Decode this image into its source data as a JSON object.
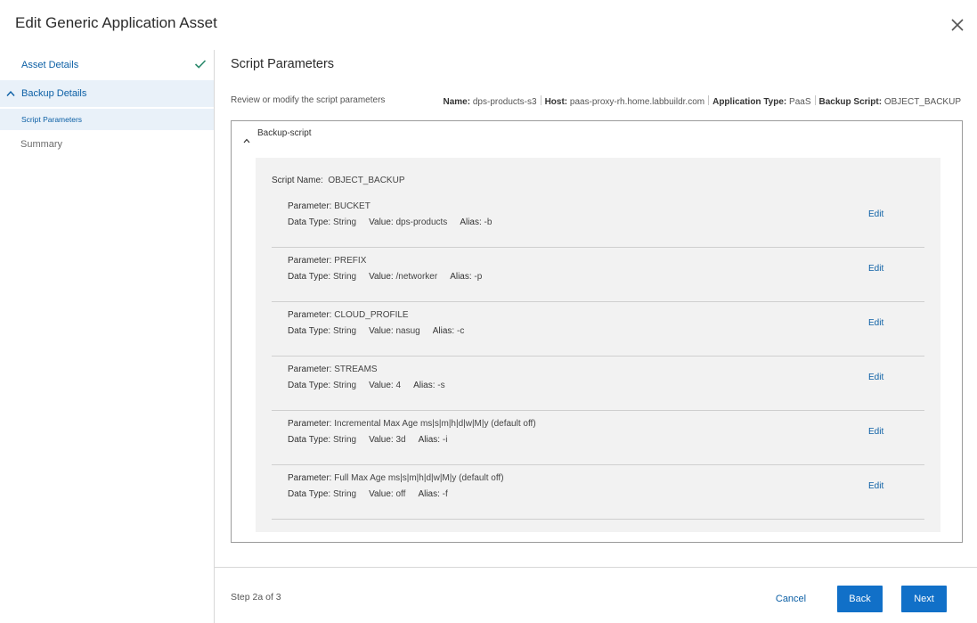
{
  "dialog": {
    "title": "Edit Generic Application Asset",
    "close_icon": "close-icon"
  },
  "sidebar": {
    "items": [
      {
        "label": "Asset Details",
        "state": "completed",
        "icon": "check-icon"
      },
      {
        "label": "Backup Details",
        "state": "expanded",
        "icon": "chevron-up-icon"
      },
      {
        "label": "Script Parameters",
        "state": "active"
      },
      {
        "label": "Summary",
        "state": "pending"
      }
    ]
  },
  "main": {
    "title": "Script Parameters",
    "subtitle": "Review or modify the script parameters",
    "meta": {
      "name_label": "Name:",
      "name_value": "dps-products-s3",
      "host_label": "Host:",
      "host_value": "paas-proxy-rh.home.labbuildr.com",
      "app_type_label": "Application Type:",
      "app_type_value": "PaaS",
      "backup_script_label": "Backup Script:",
      "backup_script_value": "OBJECT_BACKUP"
    },
    "section": {
      "title": "Backup-script",
      "script_name_label": "Script Name:",
      "script_name_value": "OBJECT_BACKUP",
      "labels": {
        "parameter": "Parameter:",
        "data_type": "Data Type:",
        "value": "Value:",
        "alias": "Alias:",
        "edit": "Edit"
      },
      "parameters": [
        {
          "name": "BUCKET",
          "data_type": "String",
          "value": "dps-products",
          "alias": "-b"
        },
        {
          "name": "PREFIX",
          "data_type": "String",
          "value": "/networker",
          "alias": "-p"
        },
        {
          "name": "CLOUD_PROFILE",
          "data_type": "String",
          "value": "nasug",
          "alias": "-c"
        },
        {
          "name": "STREAMS",
          "data_type": "String",
          "value": "4",
          "alias": "-s"
        },
        {
          "name": "Incremental Max Age ms|s|m|h|d|w|M|y (default off)",
          "data_type": "String",
          "value": "3d",
          "alias": "-i"
        },
        {
          "name": "Full Max Age ms|s|m|h|d|w|M|y (default off)",
          "data_type": "String",
          "value": "off",
          "alias": "-f"
        }
      ]
    }
  },
  "footer": {
    "step": "Step 2a of 3",
    "cancel_label": "Cancel",
    "back_label": "Back",
    "next_label": "Next"
  },
  "colors": {
    "accent": "#1170c8",
    "link": "#0b5fa5",
    "success": "#2e8b6e",
    "active_bg": "#e9f1f9"
  }
}
